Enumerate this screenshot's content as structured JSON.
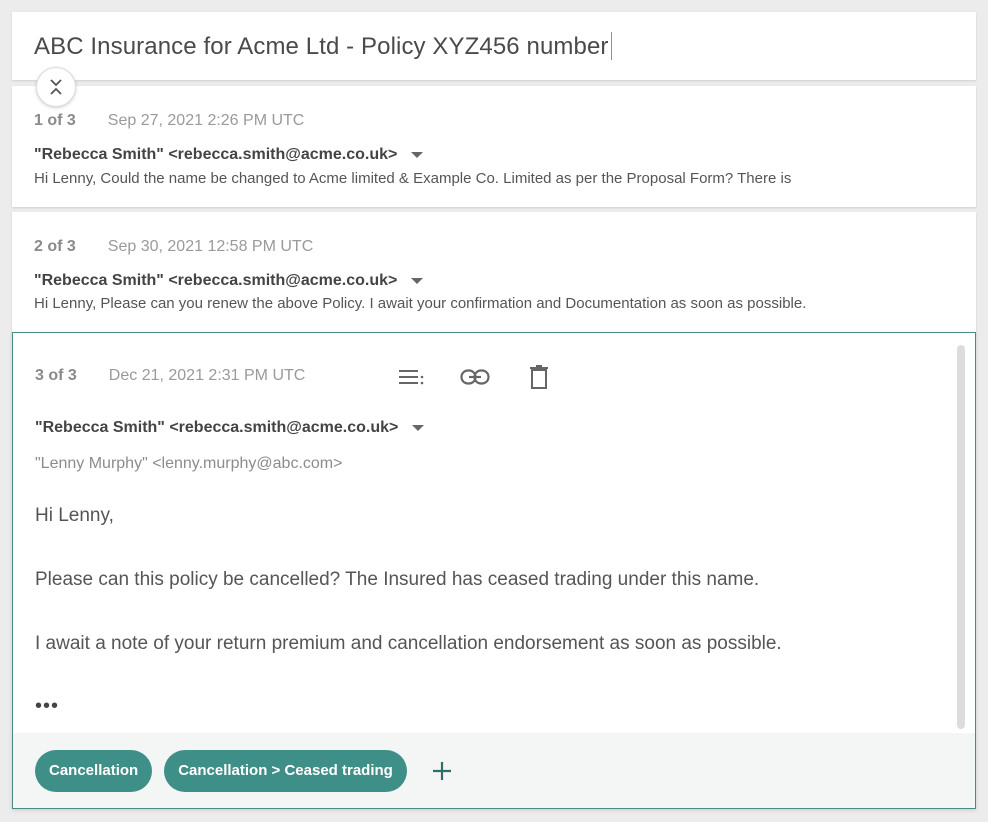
{
  "thread": {
    "title": "ABC Insurance for Acme Ltd - Policy XYZ456 number"
  },
  "messages": [
    {
      "counter": "1 of 3",
      "date": "Sep 27, 2021 2:26 PM UTC",
      "from": "\"Rebecca Smith\" <rebecca.smith@acme.co.uk>",
      "snippet": "Hi Lenny, Could the name be changed to Acme limited & Example Co. Limited as per the Proposal Form? There is"
    },
    {
      "counter": "2 of 3",
      "date": "Sep 30, 2021 12:58 PM UTC",
      "from": "\"Rebecca Smith\" <rebecca.smith@acme.co.uk>",
      "snippet": "Hi Lenny, Please can you renew the above Policy. I await your confirmation and Documentation as soon as possible."
    },
    {
      "counter": "3 of 3",
      "date": "Dec 21, 2021 2:31 PM UTC",
      "from": "\"Rebecca Smith\" <rebecca.smith@acme.co.uk>",
      "to": "\"Lenny Murphy\" <lenny.murphy@abc.com>",
      "body": [
        "Hi Lenny,",
        "Please can this policy be cancelled? The Insured has ceased trading under this name.",
        "I await a note of your return premium and cancellation endorsement as soon as possible."
      ],
      "ellipsis": "•••"
    }
  ],
  "tags": [
    "Cancellation",
    "Cancellation > Ceased trading"
  ],
  "colors": {
    "accent": "#3f8f89",
    "border_active": "#4a8a86"
  },
  "icons": {
    "collapse": "unfold-less-icon",
    "list": "list-icon",
    "link": "link-icon",
    "delete": "trash-icon",
    "dropdown": "caret-down-icon",
    "add": "plus-icon"
  }
}
